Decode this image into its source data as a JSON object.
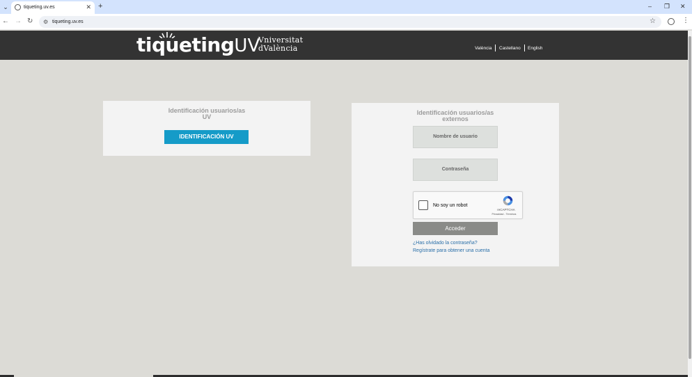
{
  "browser": {
    "tab_title": "tiqueting.uv.es",
    "url": "tiqueting.uv.es"
  },
  "header": {
    "logo_main": "tiqueting",
    "logo_suffix": "UV",
    "university_line1": "Vniversitat",
    "university_line2": "dValència",
    "languages": [
      "València",
      "Castellano",
      "English"
    ]
  },
  "login_uv": {
    "title_line1": "Identificación usuarios/as",
    "title_line2": "UV",
    "button_label": "IDENTIFICACIÓN UV"
  },
  "login_external": {
    "title_line1": "Identificación usuarios/as",
    "title_line2": "externos",
    "username_placeholder": "Nombre de usuario",
    "password_placeholder": "Contraseña",
    "captcha_label": "No soy un robot",
    "captcha_brand": "reCAPTCHA",
    "captcha_terms": "Privacidad - Términos",
    "submit_label": "Acceder",
    "forgot_link": "¿Has olvidado la contraseña?",
    "register_link": "Regístrate para obtener una cuenta"
  },
  "colors": {
    "header_bg": "#333333",
    "page_bg": "#dcdbd6",
    "uv_button": "#159bc8",
    "submit_button": "#8a8b88",
    "link": "#2a6fa8"
  }
}
